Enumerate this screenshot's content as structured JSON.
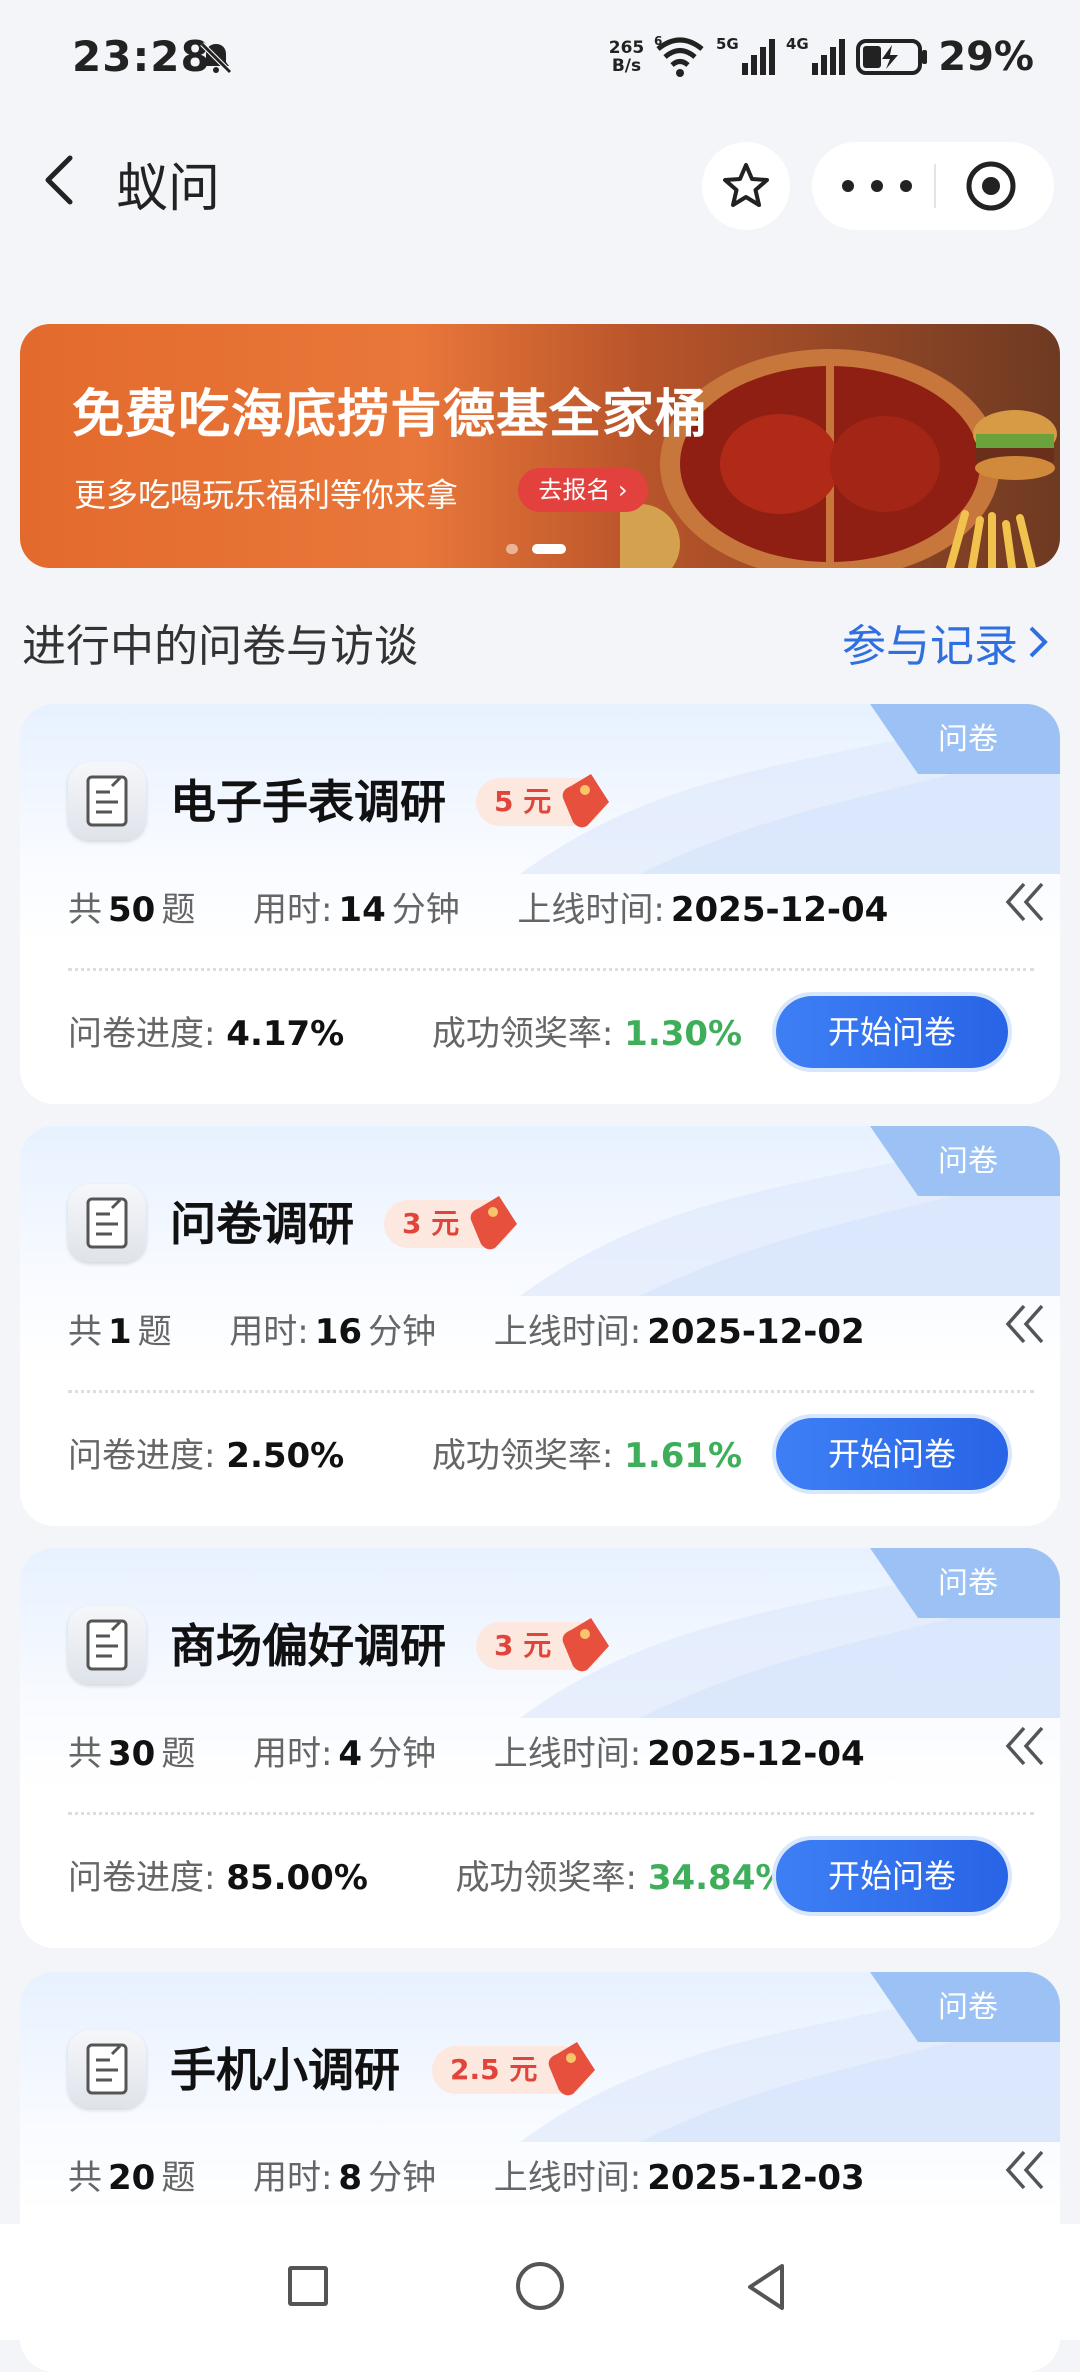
{
  "status_bar": {
    "time": "23:28",
    "net_speed_value": "265",
    "net_speed_unit": "B/s",
    "wifi_badge": "6",
    "sim1_label": "5G",
    "sim2_label": "4G",
    "battery": "29%",
    "icons": [
      "bell-muted-icon",
      "wifi-icon",
      "signal-icon",
      "battery-charging-icon"
    ]
  },
  "nav": {
    "title": "蚁问",
    "icons": [
      "back-icon",
      "star-icon",
      "more-icon",
      "target-icon"
    ]
  },
  "banner": {
    "title": "免费吃海底捞肯德基全家桶",
    "subtitle": "更多吃喝玩乐福利等你来拿",
    "button": "去报名",
    "page_count": 2,
    "active_page": 2
  },
  "section": {
    "title": "进行中的问卷与访谈",
    "link": "参与记录"
  },
  "labels": {
    "tag": "问卷",
    "count_prefix": "共",
    "count_suffix": "题",
    "duration_prefix": "用时:",
    "duration_unit": "分钟",
    "online_prefix": "上线时间:",
    "progress_prefix": "问卷进度:",
    "award_prefix": "成功领奖率:",
    "start_button": "开始问卷"
  },
  "surveys": [
    {
      "title": "电子手表调研",
      "reward": "5 元",
      "questions": "50",
      "minutes": "14",
      "online": "2025-12-04",
      "progress": "4.17%",
      "award_rate": "1.30%"
    },
    {
      "title": "问卷调研",
      "reward": "3 元",
      "questions": "1",
      "minutes": "16",
      "online": "2025-12-02",
      "progress": "2.50%",
      "award_rate": "1.61%"
    },
    {
      "title": "商场偏好调研",
      "reward": "3 元",
      "questions": "30",
      "minutes": "4",
      "online": "2025-12-04",
      "progress": "85.00%",
      "award_rate": "34.84%"
    },
    {
      "title": "手机小调研",
      "reward": "2.5 元",
      "questions": "20",
      "minutes": "8",
      "online": "2025-12-03",
      "progress": "",
      "award_rate": ""
    }
  ],
  "colors": {
    "accent_blue": "#2f6fe0",
    "button_blue": "#2864e6",
    "rate_green": "#3fae5a",
    "reward_red": "#e0443a"
  }
}
